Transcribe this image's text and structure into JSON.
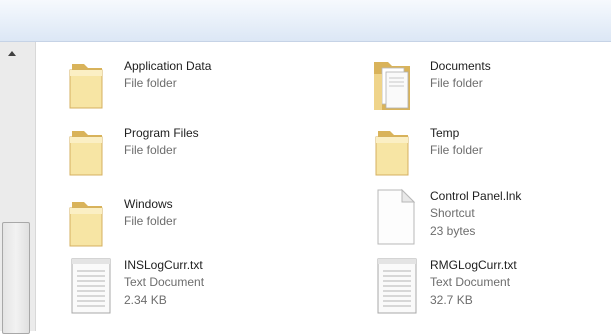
{
  "items": [
    {
      "name": "Application Data",
      "type": "File folder",
      "icon": "folder-icon"
    },
    {
      "name": "Documents",
      "type": "File folder",
      "icon": "documents-folder-icon"
    },
    {
      "name": "Program Files",
      "type": "File folder",
      "icon": "folder-icon"
    },
    {
      "name": "Temp",
      "type": "File folder",
      "icon": "folder-icon"
    },
    {
      "name": "Windows",
      "type": "File folder",
      "icon": "folder-icon"
    },
    {
      "name": "Control Panel.lnk",
      "type": "Shortcut",
      "size": "23 bytes",
      "icon": "blank-file-icon"
    },
    {
      "name": "INSLogCurr.txt",
      "type": "Text Document",
      "size": "2.34 KB",
      "icon": "text-document-icon"
    },
    {
      "name": "RMGLogCurr.txt",
      "type": "Text Document",
      "size": "32.7 KB",
      "icon": "text-document-icon"
    }
  ],
  "colors": {
    "folder_light": "#f7e5a4",
    "folder_dark": "#d9b35a",
    "name_text": "#1e1e1e",
    "meta_text": "#6d6d6d"
  }
}
